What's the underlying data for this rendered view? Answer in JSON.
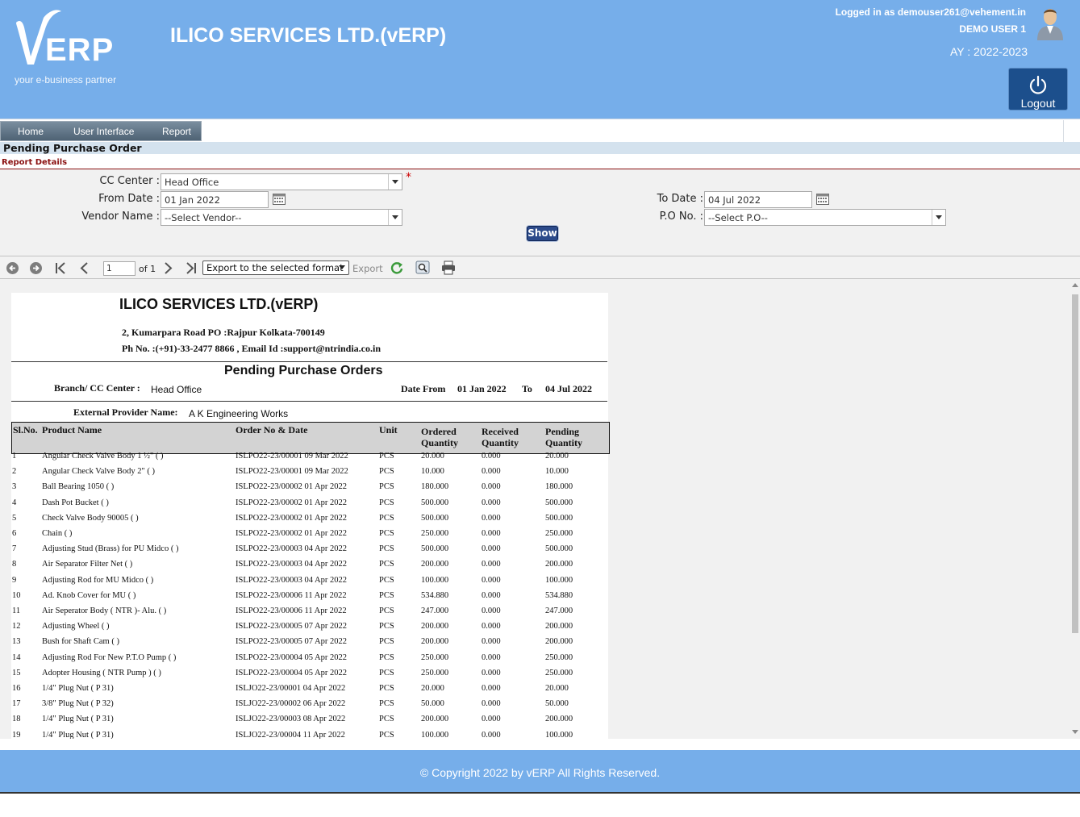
{
  "header": {
    "logo_text": "ERP",
    "logo_tagline": "your e-business partner",
    "company_title": "ILICO SERVICES LTD.(vERP)",
    "logged_in": "Logged in as demouser261@vehement.in",
    "user_name": "DEMO USER 1",
    "academic_year": "AY : 2022-2023",
    "logout_label": "Logout"
  },
  "menu": {
    "items": [
      "Home",
      "User Interface",
      "Report"
    ]
  },
  "page": {
    "title": "Pending Purchase Order",
    "section": "Report Details"
  },
  "form": {
    "cc_center_label": "CC Center :",
    "cc_center_value": "Head Office",
    "required_mark": "*",
    "from_date_label": "From Date :",
    "from_date_value": "01 Jan 2022",
    "to_date_label": "To Date :",
    "to_date_value": "04 Jul 2022",
    "vendor_label": "Vendor Name :",
    "vendor_value": "--Select Vendor--",
    "po_label": "P.O No. :",
    "po_value": "--Select P.O--",
    "show_label": "Show"
  },
  "toolbar": {
    "page_number": "1",
    "of_pages": "of 1",
    "export_select": "Export to the selected format",
    "export_label": "Export"
  },
  "report": {
    "company": "ILICO SERVICES LTD.(vERP)",
    "address": "2, Kumarpara Road PO :Rajpur Kolkata-700149",
    "phone": "Ph No. :(+91)-33-2477 8866 , Email Id :support@ntrindia.co.in",
    "title": "Pending Purchase Orders",
    "branch_label": "Branch/ CC Center :",
    "branch_value": "Head Office",
    "date_from_label": "Date From",
    "date_from": "01 Jan 2022",
    "to_label": "To",
    "date_to": "04 Jul 2022",
    "provider_label": "External Provider Name:",
    "provider_value": "A K Engineering Works",
    "columns": {
      "slno": "Sl.No.",
      "product": "Product Name",
      "order": "Order No & Date",
      "unit": "Unit",
      "ordered_1": "Ordered",
      "ordered_2": "Quantity",
      "received_1": "Received",
      "received_2": "Quantity",
      "pending_1": "Pending",
      "pending_2": "Quantity"
    },
    "rows": [
      [
        "1",
        "Angular Check Valve Body 1 ½\" ( )",
        "ISLPO22-23/00001 09 Mar 2022",
        "PCS",
        "20.000",
        "0.000",
        "20.000"
      ],
      [
        "2",
        "Angular Check Valve Body 2\" ( )",
        "ISLPO22-23/00001 09 Mar 2022",
        "PCS",
        "10.000",
        "0.000",
        "10.000"
      ],
      [
        "3",
        "Ball Bearing 1050 ( )",
        "ISLPO22-23/00002 01 Apr 2022",
        "PCS",
        "180.000",
        "0.000",
        "180.000"
      ],
      [
        "4",
        "Dash Pot Bucket ( )",
        "ISLPO22-23/00002 01 Apr 2022",
        "PCS",
        "500.000",
        "0.000",
        "500.000"
      ],
      [
        "5",
        "Check Valve Body 90005 ( )",
        "ISLPO22-23/00002 01 Apr 2022",
        "PCS",
        "500.000",
        "0.000",
        "500.000"
      ],
      [
        "6",
        "Chain ( )",
        "ISLPO22-23/00002 01 Apr 2022",
        "PCS",
        "250.000",
        "0.000",
        "250.000"
      ],
      [
        "7",
        "Adjusting Stud (Brass) for PU Midco ( )",
        "ISLPO22-23/00003 04 Apr 2022",
        "PCS",
        "500.000",
        "0.000",
        "500.000"
      ],
      [
        "8",
        "Air Separator Filter Net ( )",
        "ISLPO22-23/00003 04 Apr 2022",
        "PCS",
        "200.000",
        "0.000",
        "200.000"
      ],
      [
        "9",
        "Adjusting Rod for MU Midco ( )",
        "ISLPO22-23/00003 04 Apr 2022",
        "PCS",
        "100.000",
        "0.000",
        "100.000"
      ],
      [
        "10",
        "Ad. Knob Cover for MU ( )",
        "ISLPO22-23/00006 11 Apr 2022",
        "PCS",
        "534.880",
        "0.000",
        "534.880"
      ],
      [
        "11",
        "Air Seperator Body ( NTR )- Alu. ( )",
        "ISLPO22-23/00006 11 Apr 2022",
        "PCS",
        "247.000",
        "0.000",
        "247.000"
      ],
      [
        "12",
        "Adjusting Wheel ( )",
        "ISLPO22-23/00005 07 Apr 2022",
        "PCS",
        "200.000",
        "0.000",
        "200.000"
      ],
      [
        "13",
        "Bush for Shaft Cam ( )",
        "ISLPO22-23/00005 07 Apr 2022",
        "PCS",
        "200.000",
        "0.000",
        "200.000"
      ],
      [
        "14",
        "Adjusting Rod For New P.T.O Pump ( )",
        "ISLPO22-23/00004 05 Apr 2022",
        "PCS",
        "250.000",
        "0.000",
        "250.000"
      ],
      [
        "15",
        "Adopter Housing ( NTR Pump ) ( )",
        "ISLPO22-23/00004 05 Apr 2022",
        "PCS",
        "250.000",
        "0.000",
        "250.000"
      ],
      [
        "16",
        "1/4\" Plug Nut ( P 31)",
        "ISLJO22-23/00001 04 Apr 2022",
        "PCS",
        "20.000",
        "0.000",
        "20.000"
      ],
      [
        "17",
        "3/8\" Plug Nut ( P 32)",
        "ISLJO22-23/00002 06 Apr 2022",
        "PCS",
        "50.000",
        "0.000",
        "50.000"
      ],
      [
        "18",
        "1/4\" Plug Nut ( P 31)",
        "ISLJO22-23/00003 08 Apr 2022",
        "PCS",
        "200.000",
        "0.000",
        "200.000"
      ],
      [
        "19",
        "1/4\" Plug Nut ( P 31)",
        "ISLJO22-23/00004 11 Apr 2022",
        "PCS",
        "100.000",
        "0.000",
        "100.000"
      ]
    ]
  },
  "footer": {
    "copyright": "© Copyright 2022 by vERP All Rights Reserved."
  }
}
